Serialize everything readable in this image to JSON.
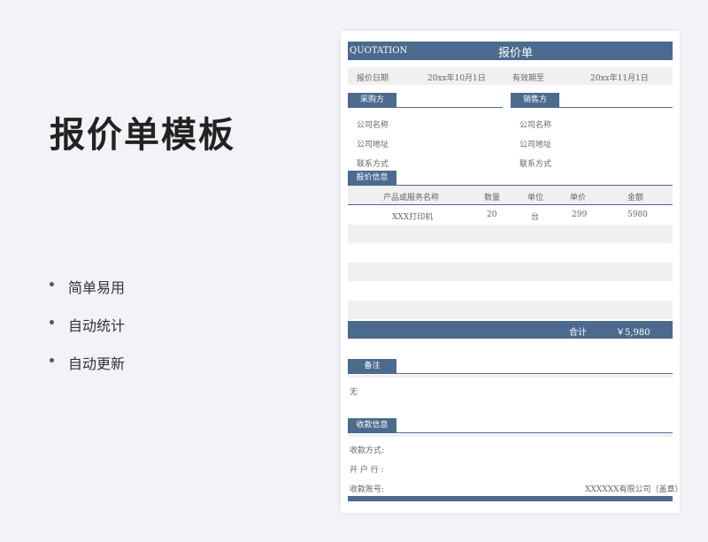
{
  "promo": {
    "title": "报价单模板",
    "features": [
      "简单易用",
      "自动统计",
      "自动更新"
    ]
  },
  "sheet": {
    "header_en": "QUOTATION",
    "header_cn": "报价单",
    "date_label": "报价日期",
    "date_value": "20xx年10月1日",
    "valid_label": "有效期至",
    "valid_value": "20xx年11月1日",
    "buyer_label": "采购方",
    "seller_label": "销售方",
    "buyer_fields": [
      "公司名称",
      "公司地址",
      "联系方式"
    ],
    "seller_fields": [
      "公司名称",
      "公司地址",
      "联系方式"
    ],
    "quote_label": "报价信息",
    "columns": [
      "产品或服务名称",
      "数量",
      "单位",
      "单价",
      "金额"
    ],
    "rows": [
      [
        "XXX打印机",
        "20",
        "台",
        "299",
        "5980"
      ]
    ],
    "total_label": "合计",
    "total_value": "￥5,980",
    "notes_label": "备注",
    "notes_value": "无",
    "payment_label": "收款信息",
    "payment_method": "收款方式:",
    "bank": "开 户 行 :",
    "account": "收款账号:",
    "company_seal": "XXXXXX有限公司（盖章）"
  },
  "colors": {
    "accent": "#4b6a8e",
    "stripe": "#f0f0f0",
    "page_bg": "#f1f3f6"
  }
}
